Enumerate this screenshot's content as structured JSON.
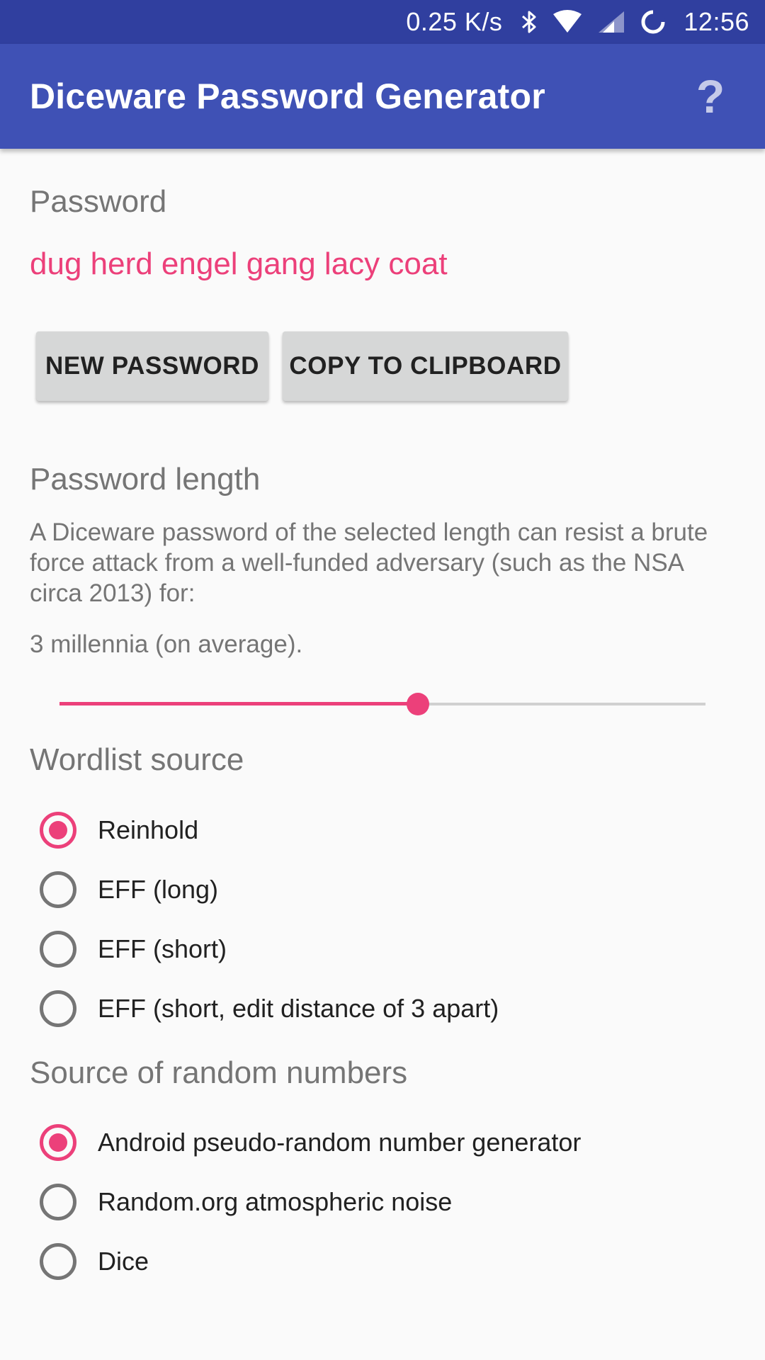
{
  "status_bar": {
    "net_speed": "0.25 K/s",
    "time": "12:56",
    "icons": [
      "bluetooth-icon",
      "wifi-icon",
      "cell-signal-icon",
      "sync-icon"
    ]
  },
  "app_bar": {
    "title": "Diceware Password Generator",
    "help_label": "?"
  },
  "password_section": {
    "heading": "Password",
    "value": "dug herd engel gang lacy coat",
    "new_button": "NEW PASSWORD",
    "copy_button": "COPY TO CLIPBOARD"
  },
  "length_section": {
    "heading": "Password length",
    "description": "A Diceware password of the selected length can resist a brute force attack from a well-funded adversary (such as the NSA circa 2013) for:",
    "estimate": "3 millennia (on average).",
    "slider_fraction": 0.555
  },
  "wordlist_section": {
    "heading": "Wordlist source",
    "options": [
      {
        "label": "Reinhold",
        "checked": true
      },
      {
        "label": "EFF (long)",
        "checked": false
      },
      {
        "label": "EFF (short)",
        "checked": false
      },
      {
        "label": "EFF (short, edit distance of 3 apart)",
        "checked": false
      }
    ]
  },
  "random_section": {
    "heading": "Source of random numbers",
    "options": [
      {
        "label": "Android pseudo-random number generator",
        "checked": true
      },
      {
        "label": "Random.org atmospheric noise",
        "checked": false
      },
      {
        "label": "Dice",
        "checked": false
      }
    ]
  },
  "colors": {
    "status_bar": "#303f9f",
    "primary": "#3f51b5",
    "accent": "#ec407a",
    "secondary_text": "#757575",
    "button_bg": "#d6d7d7"
  }
}
